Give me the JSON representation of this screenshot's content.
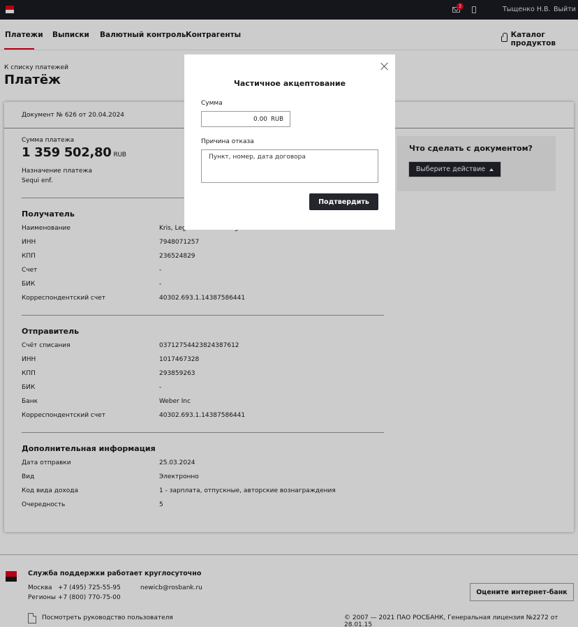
{
  "topbar": {
    "mail_badge": "3",
    "user_name": "Тыщенко Н.В.",
    "logout": "Выйти"
  },
  "nav": {
    "items": [
      "Платежи",
      "Выписки",
      "Валютный контроль",
      "Контрагенты"
    ],
    "active_index": 0,
    "catalog": "Каталог продуктов"
  },
  "page": {
    "back_link": "К списку платежей",
    "title": "Платёж"
  },
  "document": {
    "header": "Документ № 626 от 20.04.2024",
    "sum_label": "Сумма платежа",
    "amount": "1 359 502,80",
    "currency": "RUB",
    "purpose_label": "Назначение платежа",
    "purpose": "Sequi enf."
  },
  "recipient": {
    "title": "Получатель",
    "rows": [
      {
        "label": "Наименование",
        "value": "Kris, Legros and Cartwright"
      },
      {
        "label": "ИНН",
        "value": "7948071257"
      },
      {
        "label": "КПП",
        "value": "236524829"
      },
      {
        "label": "Счет",
        "value": "-"
      },
      {
        "label": "БИК",
        "value": "-"
      },
      {
        "label": "Корреспондентский счет",
        "value": "40302.693.1.14387586441"
      }
    ]
  },
  "sender": {
    "title": "Отправитель",
    "rows": [
      {
        "label": "Счёт списания",
        "value": "03712754423824387612"
      },
      {
        "label": "ИНН",
        "value": "1017467328"
      },
      {
        "label": "КПП",
        "value": "293859263"
      },
      {
        "label": "БИК",
        "value": "-"
      },
      {
        "label": "Банк",
        "value": "Weber Inc"
      },
      {
        "label": "Корреспондентский счет",
        "value": "40302.693.1.14387586441"
      }
    ]
  },
  "additional": {
    "title": "Дополнительная информация",
    "rows": [
      {
        "label": "Дата отправки",
        "value": "25.03.2024"
      },
      {
        "label": "Вид",
        "value": "Электронно"
      },
      {
        "label": "Код вида дохода",
        "value": "1 - зарплата, отпускные, авторские вознаграждения"
      },
      {
        "label": "Очередность",
        "value": "5"
      }
    ]
  },
  "actions": {
    "title": "Что сделать с документом?",
    "button": "Выберите действие"
  },
  "modal": {
    "title": "Частичное акцептование",
    "sum_label": "Сумма",
    "sum_value": "0.00",
    "sum_currency": "RUB",
    "reason_label": "Причина отказа",
    "reason_placeholder": "Пункт, номер, дата договора",
    "confirm": "Подтвердить"
  },
  "footer": {
    "support_title": "Служба поддержки работает круглосуточно",
    "moscow": "Москва   +7 (495) 725-55-95",
    "regions": "Регионы +7 (800) 770-75-00",
    "email": "newicb@rosbank.ru",
    "rate_button": "Оцените интернет-банк",
    "manual": "Посмотреть руководство пользователя",
    "copyright": "© 2007 — 2021 ПАО РОСБАНК, Генеральная лицензия №2272 от 28.01.15"
  },
  "colors": {
    "brand_red": "#e3001b",
    "dark": "#24252d",
    "topbar": "#1b1c22"
  }
}
